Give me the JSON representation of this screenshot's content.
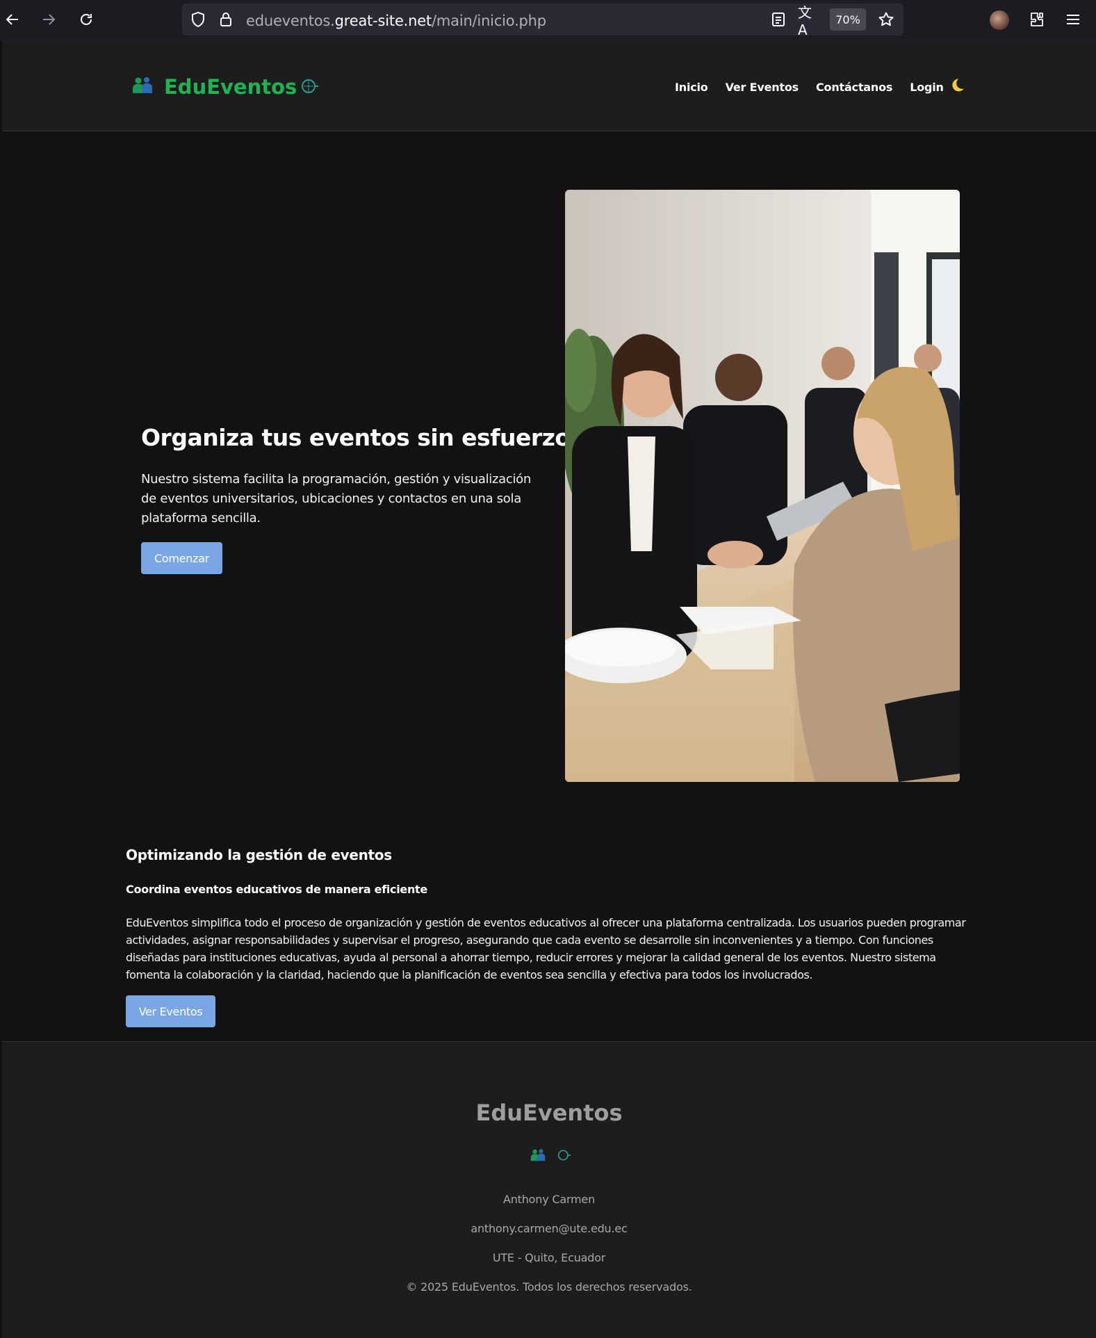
{
  "browser": {
    "url_prefix": "edueventos.",
    "url_domain": "great-site.net",
    "url_path": "/main/inicio.php",
    "zoom": "70%"
  },
  "header": {
    "brand": "EduEventos",
    "nav": [
      "Inicio",
      "Ver Eventos",
      "Contáctanos",
      "Login"
    ],
    "theme_icon": "moon-icon"
  },
  "hero": {
    "title": "Organiza tus eventos sin esfuerzo",
    "description": "Nuestro sistema facilita la programación, gestión y visualización de eventos universitarios, ubicaciones y contactos en una sola plataforma sencilla.",
    "button": "Comenzar"
  },
  "section": {
    "title": "Optimizando la gestión de eventos",
    "subtitle": "Coordina eventos educativos de manera eficiente",
    "body": "EduEventos simplifica todo el proceso de organización y gestión de eventos educativos al ofrecer una plataforma centralizada. Los usuarios pueden programar actividades, asignar responsabilidades y supervisar el progreso, asegurando que cada evento se desarrolle sin inconvenientes y a tiempo. Con funciones diseñadas para instituciones educativas, ayuda al personal a ahorrar tiempo, reducir errores y mejorar la calidad general de los eventos. Nuestro sistema fomenta la colaboración y la claridad, haciendo que la planificación de eventos sea sencilla y efectiva para todos los involucrados.",
    "button": "Ver Eventos"
  },
  "footer": {
    "brand": "EduEventos",
    "author": "Anthony Carmen",
    "email": "anthony.carmen@ute.edu.ec",
    "location": "UTE - Quito, Ecuador",
    "copyright": "© 2025 EduEventos. Todos los derechos reservados."
  },
  "colors": {
    "accent_green": "#1fb451",
    "button_blue": "#7ba6e6",
    "background": "#121213"
  }
}
